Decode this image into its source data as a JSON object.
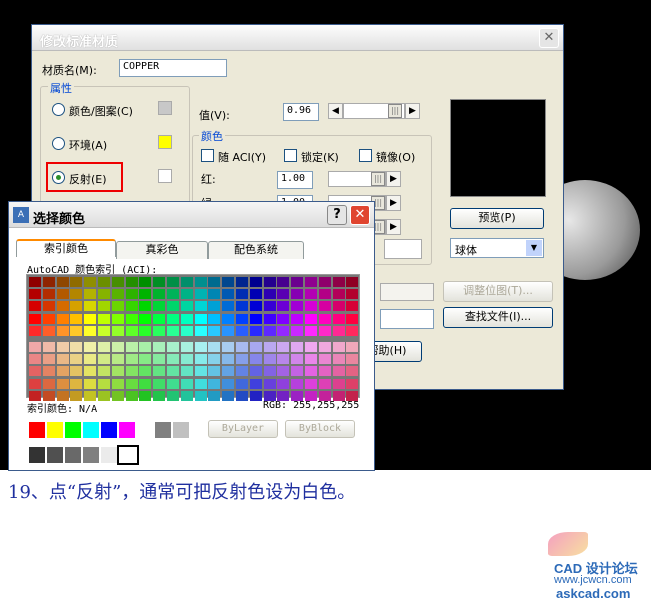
{
  "material_dialog": {
    "title": "修改标准材质",
    "name_label": "材质名(M):",
    "name_value": "COPPER",
    "attributes_label": "属性",
    "radio_color_pattern": "颜色/图案(C)",
    "radio_ambient": "环境(A)",
    "radio_reflection": "反射(E)",
    "value_label": "值(V):",
    "value": "0.96",
    "color_group_label": "颜色",
    "chk_aci": "随 ACI(Y)",
    "chk_lock": "锁定(K)",
    "chk_mirror": "镜像(O)",
    "red_label": "红:",
    "red_value": "1.00",
    "green_label": "绿:",
    "green_value": "1.00",
    "preview_button": "预览(P)",
    "shape_select": "球体",
    "adjust_map_button": "调整位图(T)...",
    "find_file_button": "查找文件(I)...",
    "help_button": "帮助(H)",
    "swatch_colors": [
      "#c8c8c8",
      "#ffff00",
      "#ffffff"
    ]
  },
  "color_dialog": {
    "title": "选择颜色",
    "icon": "autocad-icon",
    "help_button": "?",
    "tabs": [
      "索引颜色",
      "真彩色",
      "配色系统"
    ],
    "aci_label": "AutoCAD 颜色索引 (ACI):",
    "index_color_label": "索引颜色: N/A",
    "rgb_label": "RGB: 255,255,255",
    "bylayer_button": "ByLayer",
    "byblock_button": "ByBlock",
    "standard_colors": [
      "#ff0000",
      "#ffff00",
      "#00ff00",
      "#00ffff",
      "#0000ff",
      "#ff00ff",
      "#ffffff",
      "#808080",
      "#c0c0c0"
    ],
    "gray_colors": [
      "#333333",
      "#505050",
      "#696969",
      "#808080",
      "#ebebeb"
    ]
  },
  "caption": "19、点“反射”，通常可把反射色设为白色。",
  "watermark": {
    "logo": "CAD 设计论坛",
    "url1": "www.jcwcn.com",
    "url2": "askcad.com"
  }
}
